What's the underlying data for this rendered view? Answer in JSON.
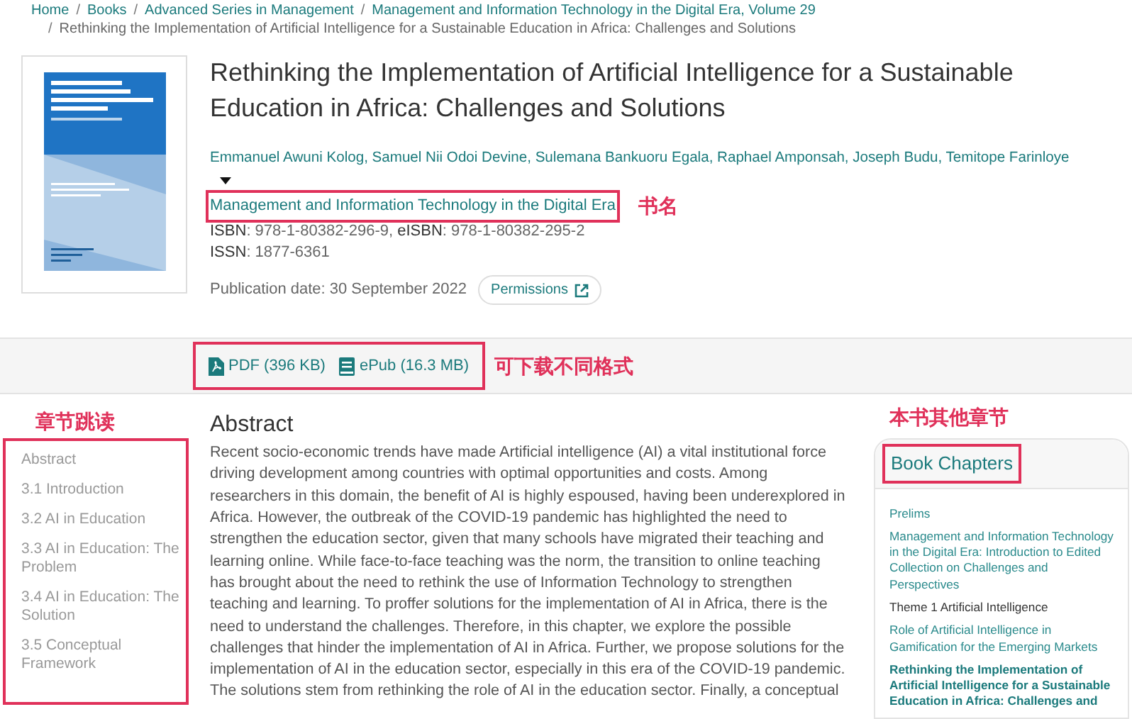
{
  "breadcrumb": {
    "separator": "/",
    "links": [
      "Home",
      "Books",
      "Advanced Series in Management",
      "Management and Information Technology in the Digital Era, Volume 29"
    ],
    "current": "Rethinking the Implementation of Artificial Intelligence for a Sustainable Education in Africa: Challenges and Solutions"
  },
  "chapter": {
    "title": "Rethinking the Implementation of Artificial Intelligence for a Sustainable Education in Africa: Challenges and Solutions",
    "authors": "Emmanuel Awuni Kolog, Samuel Nii Odoi Devine, Sulemana Bankuoru Egala, Raphael Amponsah, Joseph Budu, Temitope Farinloye",
    "book": {
      "text": "Management and Information Technology in the Digital Era",
      "highlighted": true,
      "note": "书名"
    },
    "identifiers": [
      [
        {
          "label": "ISBN",
          "value": ": 978-1-80382-296-9, "
        },
        {
          "label": "eISBN",
          "value": ": 978-1-80382-295-2"
        }
      ],
      [
        {
          "label": "ISSN",
          "value": ": 1877-6361"
        }
      ]
    ],
    "publication_date": "Publication date: 30 September 2022",
    "permissions": "Permissions"
  },
  "downloads": {
    "highlighted": true,
    "note": "可下载不同格式",
    "items": [
      {
        "kind": "pdf",
        "label": "PDF (396 KB)"
      },
      {
        "kind": "epub",
        "label": "ePub (16.3 MB)"
      }
    ]
  },
  "toc": {
    "note": "章节跳读",
    "highlighted": true,
    "items": [
      "Abstract",
      "3.1 Introduction",
      "3.2 AI in Education",
      "3.3 AI in Education: The Problem",
      "3.4 AI in Education: The Solution",
      "3.5 Conceptual Framework"
    ]
  },
  "abstract": {
    "heading": "Abstract",
    "text": "Recent socio-economic trends have made Artificial intelligence (AI) a vital institutional force driving development among countries with optimal opportunities and costs. Among researchers in this domain, the benefit of AI is highly espoused, having been underexplored in Africa. However, the outbreak of the COVID-19 pandemic has highlighted the need to strengthen the education sector, given that many schools have migrated their teaching and learning online. While face-to-face teaching was the norm, the transition to online teaching has brought about the need to rethink the use of Information Technology to strengthen teaching and learning. To proffer solutions for the implementation of AI in Africa, there is the need to understand the challenges. Therefore, in this chapter, we explore the possible challenges that hinder the implementation of AI in Africa. Further, we propose solutions for the implementation of AI in the education sector, especially in this era of the COVID-19 pandemic. The solutions stem from rethinking the role of AI in the education sector. Finally, a conceptual"
  },
  "sidebar": {
    "note": "本书其他章节",
    "title": "Book Chapters",
    "highlighted": true,
    "items": [
      {
        "kind": "link",
        "text": "Prelims"
      },
      {
        "kind": "link",
        "text": "Management and Information Technology in the Digital Era: Introduction to Edited Collection on Challenges and Perspectives"
      },
      {
        "kind": "heading",
        "text": "Theme 1 Artificial Intelligence"
      },
      {
        "kind": "link",
        "text": "Role of Artificial Intelligence in Gamification for the Emerging Markets"
      },
      {
        "kind": "current",
        "text": "Rethinking the Implementation of Artificial Intelligence for a Sustainable Education in Africa: Challenges and"
      }
    ]
  }
}
